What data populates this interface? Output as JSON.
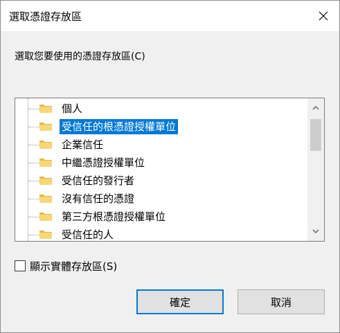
{
  "window": {
    "title": "選取憑證存放區"
  },
  "prompt": "選取您要使用的憑證存放區(C)",
  "stores": [
    {
      "label": "個人",
      "selected": false
    },
    {
      "label": "受信任的根憑證授權單位",
      "selected": true
    },
    {
      "label": "企業信任",
      "selected": false
    },
    {
      "label": "中繼憑證授權單位",
      "selected": false
    },
    {
      "label": "受信任的發行者",
      "selected": false
    },
    {
      "label": "沒有信任的憑證",
      "selected": false
    },
    {
      "label": "第三方根憑證授權單位",
      "selected": false
    },
    {
      "label": "受信任的人",
      "selected": false
    }
  ],
  "show_physical": {
    "label": "顯示實體存放區(S)",
    "checked": false
  },
  "buttons": {
    "ok": "確定",
    "cancel": "取消"
  },
  "colors": {
    "selection": "#0078d7",
    "folder": "#f8d775",
    "default_button_border": "#0078d7"
  },
  "icons": {
    "folder": "folder-icon",
    "close": "close-icon",
    "scroll_up": "scroll-up-icon",
    "scroll_down": "scroll-down-icon"
  }
}
